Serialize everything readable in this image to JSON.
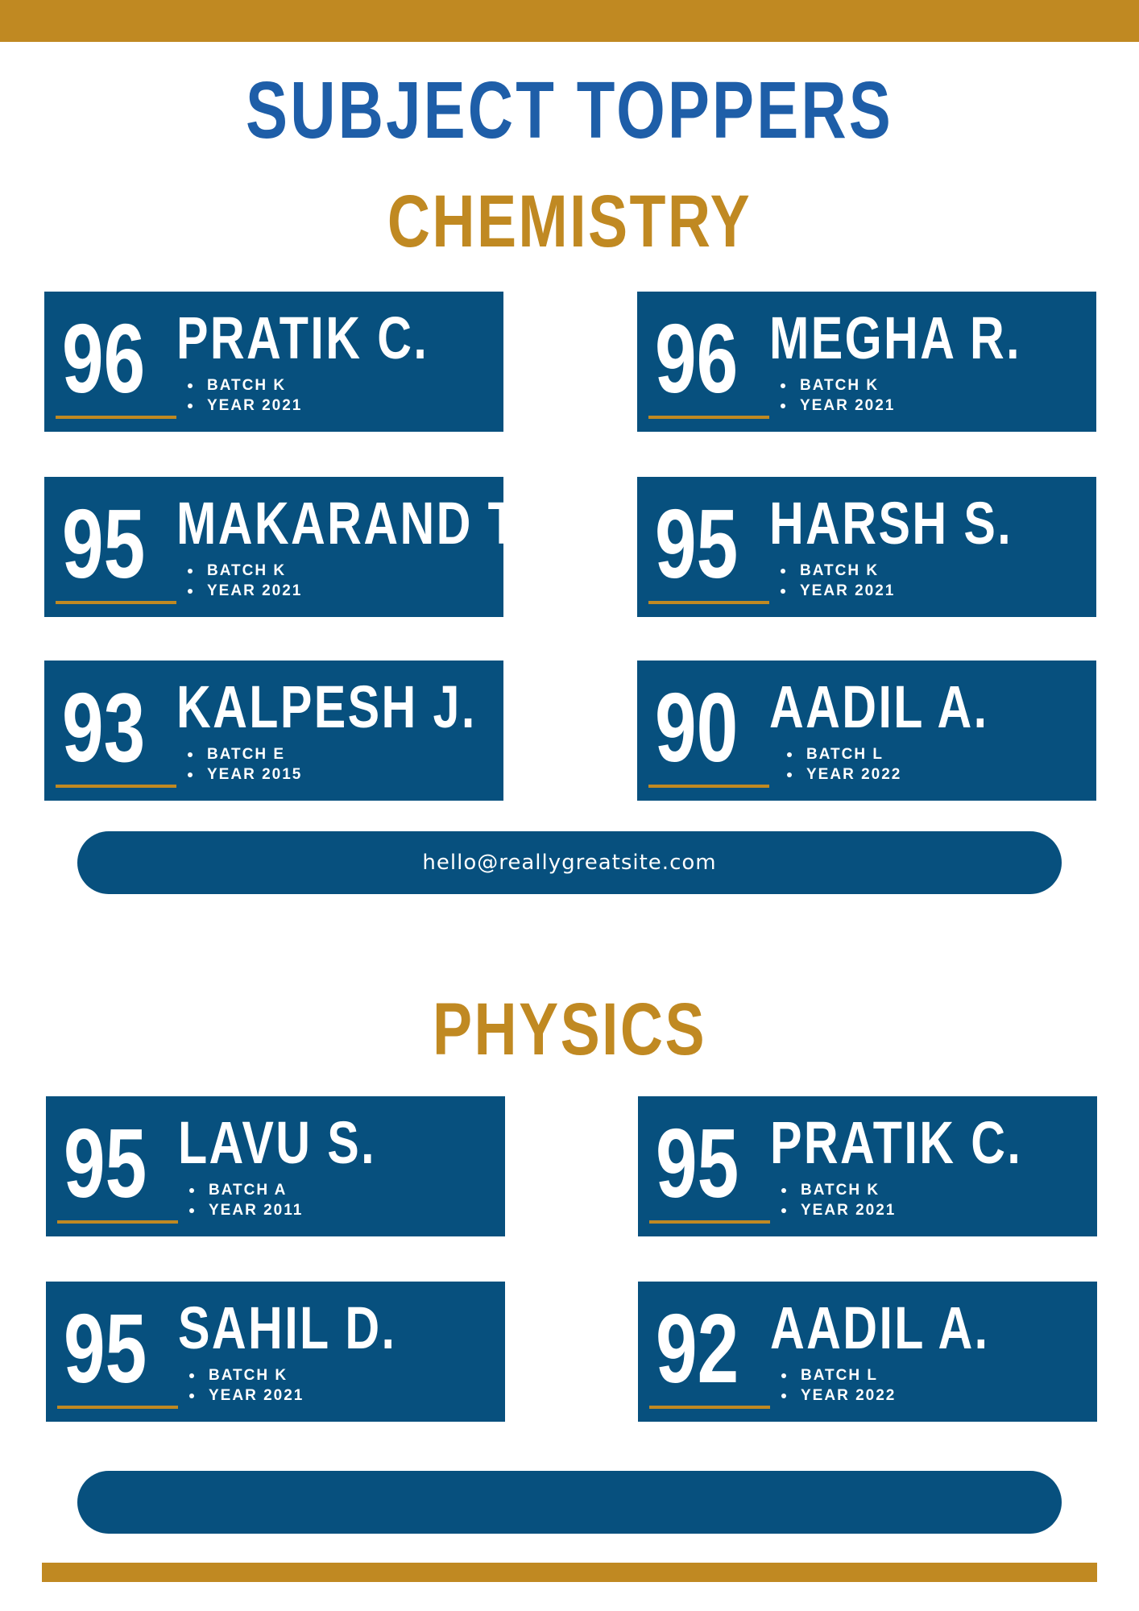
{
  "main_title": "SUBJECT TOPPERS",
  "sections": [
    {
      "title": "CHEMISTRY",
      "toppers": [
        {
          "score": "96",
          "name": "PRATIK C.",
          "batch": "BATCH K",
          "year": "YEAR 2021"
        },
        {
          "score": "96",
          "name": "MEGHA R.",
          "batch": "BATCH K",
          "year": "YEAR 2021"
        },
        {
          "score": "95",
          "name": "MAKARAND T.",
          "batch": "BATCH K",
          "year": "YEAR 2021"
        },
        {
          "score": "95",
          "name": "HARSH S.",
          "batch": "BATCH K",
          "year": "YEAR 2021"
        },
        {
          "score": "93",
          "name": "KALPESH J.",
          "batch": "BATCH E",
          "year": "YEAR 2015"
        },
        {
          "score": "90",
          "name": "AADIL A.",
          "batch": "BATCH L",
          "year": "YEAR 2022"
        }
      ],
      "footer_text": "hello@reallygreatsite.com"
    },
    {
      "title": "PHYSICS",
      "toppers": [
        {
          "score": "95",
          "name": "LAVU S.",
          "batch": "BATCH A",
          "year": "YEAR 2011"
        },
        {
          "score": "95",
          "name": "PRATIK C.",
          "batch": "BATCH K",
          "year": "YEAR 2021"
        },
        {
          "score": "95",
          "name": "SAHIL D.",
          "batch": "BATCH K",
          "year": "YEAR 2021"
        },
        {
          "score": "92",
          "name": "AADIL A.",
          "batch": "BATCH L",
          "year": "YEAR 2022"
        }
      ],
      "footer_text": ""
    }
  ]
}
